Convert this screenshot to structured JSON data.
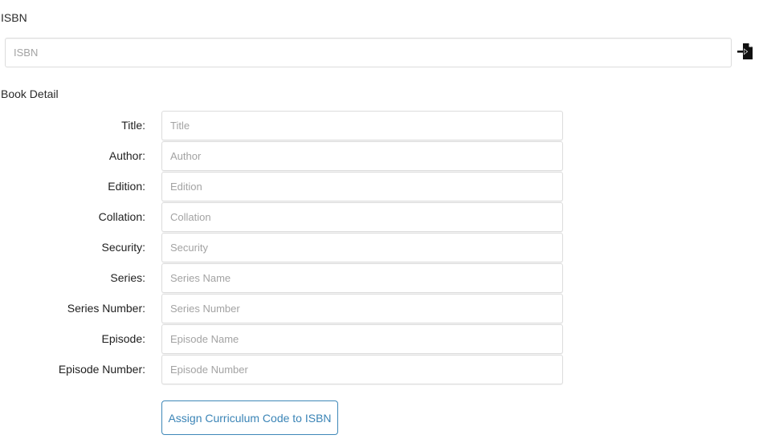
{
  "isbn": {
    "label": "ISBN",
    "placeholder": "ISBN",
    "value": "",
    "import_icon": "import-file-icon"
  },
  "book_detail": {
    "section_label": "Book Detail",
    "fields": [
      {
        "label": "Title:",
        "placeholder": "Title",
        "value": ""
      },
      {
        "label": "Author:",
        "placeholder": "Author",
        "value": ""
      },
      {
        "label": "Edition:",
        "placeholder": "Edition",
        "value": ""
      },
      {
        "label": "Collation:",
        "placeholder": "Collation",
        "value": ""
      },
      {
        "label": "Security:",
        "placeholder": "Security",
        "value": ""
      },
      {
        "label": "Series:",
        "placeholder": "Series Name",
        "value": ""
      },
      {
        "label": "Series Number:",
        "placeholder": "Series Number",
        "value": ""
      },
      {
        "label": "Episode:",
        "placeholder": "Episode Name",
        "value": ""
      },
      {
        "label": "Episode Number:",
        "placeholder": "Episode Number",
        "value": ""
      }
    ]
  },
  "actions": {
    "assign_label": "Assign Curriculum Code to ISBN"
  },
  "colors": {
    "accent": "#3a84b6",
    "border": "#dcdcdc",
    "placeholder": "#a3a3a3",
    "text": "#222222"
  }
}
